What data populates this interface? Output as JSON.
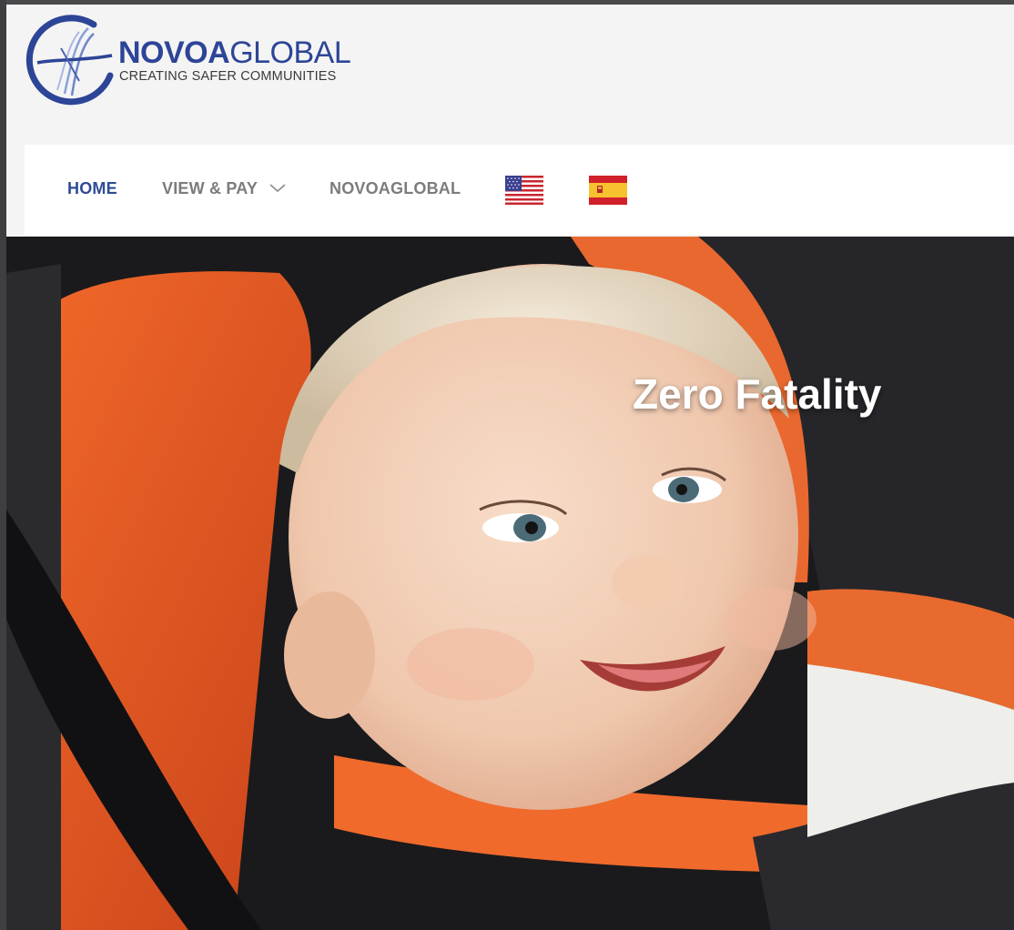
{
  "brand": {
    "name_bold": "NOVOA",
    "name_light": "GLOBAL",
    "tagline": "CREATING SAFER COMMUNITIES",
    "accent": "#2d4597"
  },
  "nav": {
    "items": [
      {
        "label": "HOME",
        "active": true
      },
      {
        "label": "VIEW & PAY",
        "has_dropdown": true
      },
      {
        "label": "NOVOAGLOBAL"
      }
    ],
    "flags": [
      {
        "icon": "us-flag-icon"
      },
      {
        "icon": "spain-flag-icon"
      }
    ],
    "active_color": "#2e4c96",
    "inactive_color": "#7c7c7c"
  },
  "hero": {
    "title": "Zero Fatality"
  }
}
